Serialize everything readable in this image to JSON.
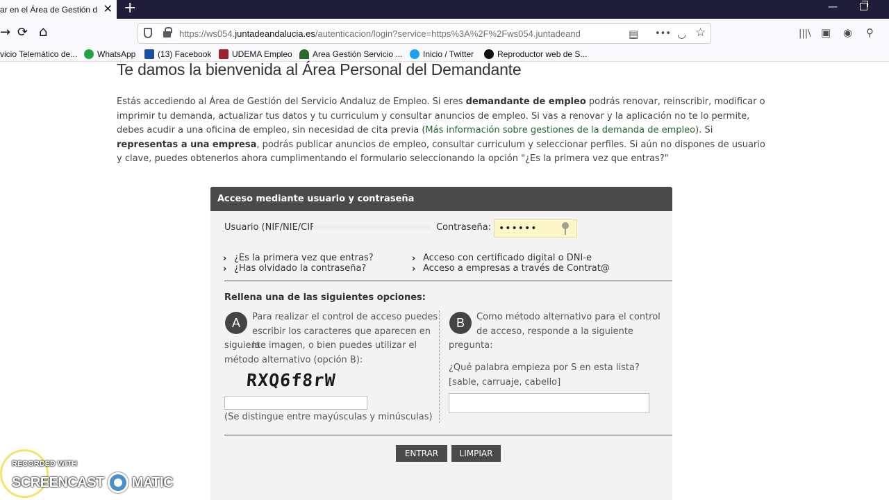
{
  "browser": {
    "tab_title": "ar en el Área de Gestión del",
    "tab_close": "✕",
    "new_tab": "+",
    "nav": {
      "back": "→",
      "reload": "⟳",
      "home": "⌂"
    },
    "url_prefix": "https://ws054.",
    "url_domain": "juntadeandalucia.es",
    "url_path": "/autenticacion/login?service=https%3A%2F%2Fws054.juntadeand",
    "url_icons": {
      "reader": "▤",
      "more": "•••",
      "pocket": "◡",
      "star": "☆"
    },
    "tool_icons": {
      "library": "|||\\",
      "sidebar": "▣",
      "account": "◉",
      "extension": "⚲"
    }
  },
  "bookmarks": [
    {
      "label": "vicio Telemático de...",
      "icon": "none"
    },
    {
      "label": "WhatsApp",
      "icon": "whatsapp-icon",
      "color": "#25a244"
    },
    {
      "label": "(13) Facebook",
      "icon": "facebook-icon",
      "color": "#1b4ea0"
    },
    {
      "label": "UDEMA Empleo",
      "icon": "udema-icon",
      "color": "#a02030"
    },
    {
      "label": "Area Gestión Servicio ...",
      "icon": "junta-icon",
      "color": "#2a6a2a"
    },
    {
      "label": "Inicio / Twitter",
      "icon": "twitter-icon",
      "color": "#1da1f2"
    },
    {
      "label": "Reproductor web de S...",
      "icon": "spotify-icon",
      "color": "#111111"
    }
  ],
  "page": {
    "title": "Te damos la bienvenida al Área Personal del Demandante",
    "intro": {
      "p1": "Estás accediendo al Área de Gestión del Servicio Andaluz de Empleo. Si eres ",
      "b1": "demandante de empleo",
      "p2": " podrás renovar, reinscribir, modificar o imprimir tu demanda, actualizar tus datos y tu curriculum y consultar anuncios de empleo. Si vas a renovar y la aplicación no te lo permite, debes acudir a una oficina de empleo, sin necesidad de cita previa (",
      "link": "Más información sobre gestiones de la demanda de empleo",
      "p3": "). Si ",
      "b2": "representas a una empresa",
      "p4": ", podrás publicar anuncios de empleo, consultar curriculum y seleccionar perfiles. Si aún no dispones de usuario y clave, puedes obtenerlos ahora cumplimentando el formulario seleccionando la opción \"¿Es la primera vez que entras?\""
    }
  },
  "login": {
    "header": "Acceso mediante usuario y contraseña",
    "user_label": "Usuario (NIF/NIE/CIF",
    "password_label": "Contraseña:",
    "password_value": "••••••",
    "links": {
      "first_time": "¿Es la primera vez que entras?",
      "forgot": "¿Has olvidado la contraseña?",
      "certificate": "Acceso con certificado digital o DNI-e",
      "companies": "Acceso a empresas a través de Contrat@"
    },
    "options_title": "Rellena una de las siguientes opciones:",
    "option_a": {
      "badge": "A",
      "text_top": "Para realizar el control de acceso puedes escribir los caracteres que aparecen en la",
      "text_bottom": "siguiente imagen, o bien puedes utilizar el método alternativo (opción B):",
      "captcha": "RXQ6f8rW",
      "hint": "(Se distingue entre mayúsculas y minúsculas)"
    },
    "option_b": {
      "badge": "B",
      "text_top": "Como método alternativo para el control de acceso, responde a la siguiente",
      "text_bottom": "pregunta:",
      "question": "¿Qué palabra empieza por S en esta lista?",
      "choices": "[sable, carruaje, cabello]"
    },
    "buttons": {
      "enter": "ENTRAR",
      "clear": "LIMPIAR"
    }
  },
  "watermark": {
    "line1": "RECORDED WITH",
    "word1": "SCREENCAST",
    "word2": "MATIC"
  }
}
